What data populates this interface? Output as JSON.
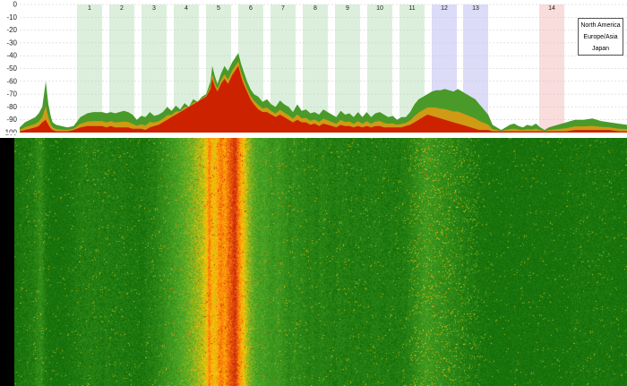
{
  "spectrum": {
    "y_ticks": [
      "0",
      "-10",
      "-20",
      "-30",
      "-40",
      "-50",
      "-60",
      "-70",
      "-80",
      "-90",
      "-100"
    ],
    "channels": [
      {
        "label": "1",
        "region": "north_america"
      },
      {
        "label": "2",
        "region": "north_america"
      },
      {
        "label": "3",
        "region": "north_america"
      },
      {
        "label": "4",
        "region": "north_america"
      },
      {
        "label": "5",
        "region": "north_america"
      },
      {
        "label": "6",
        "region": "north_america"
      },
      {
        "label": "7",
        "region": "north_america"
      },
      {
        "label": "8",
        "region": "north_america"
      },
      {
        "label": "9",
        "region": "north_america"
      },
      {
        "label": "10",
        "region": "north_america"
      },
      {
        "label": "11",
        "region": "north_america"
      },
      {
        "label": "12",
        "region": "europe_asia"
      },
      {
        "label": "13",
        "region": "europe_asia"
      },
      {
        "label": "14",
        "region": "japan"
      }
    ],
    "legend": {
      "north_america": "North America",
      "europe_asia": "Europe/Asia",
      "japan": "Japan"
    },
    "colors": {
      "north_america": "#dcefdc",
      "europe_asia": "#dcdcf8",
      "japan": "#f9dcdc",
      "trace_green": "#4a9a2a",
      "trace_red": "#cc2200",
      "trace_orange": "#e89a10"
    }
  },
  "chart_data": {
    "type": "area",
    "ylim": [
      -100,
      0
    ],
    "x": [
      0,
      6,
      12,
      18,
      22,
      26,
      30,
      33,
      36,
      38,
      42,
      48,
      55,
      62,
      70,
      78,
      85,
      90,
      95,
      100,
      105,
      110,
      115,
      120,
      125,
      130,
      135,
      140,
      145,
      150,
      155,
      160,
      165,
      170,
      175,
      180,
      185,
      190,
      195,
      200,
      205,
      210,
      215,
      220,
      222,
      225,
      228,
      232,
      236,
      240,
      245,
      250,
      252,
      255,
      258,
      262,
      266,
      270,
      275,
      280,
      285,
      290,
      295,
      300,
      305,
      310,
      315,
      320,
      325,
      330,
      335,
      340,
      345,
      350,
      355,
      360,
      365,
      370,
      375,
      380,
      385,
      390,
      395,
      400,
      405,
      410,
      415,
      420,
      425,
      430,
      435,
      440,
      445,
      450,
      455,
      460,
      465,
      470,
      475,
      480,
      485,
      490,
      495,
      500,
      505,
      510,
      515,
      520,
      525,
      530,
      535,
      540,
      545,
      550,
      555,
      560,
      565,
      570,
      575,
      580,
      585,
      590,
      595,
      600,
      605,
      610,
      615,
      620,
      625,
      630,
      640,
      650,
      660,
      670,
      680,
      690,
      700
    ],
    "series": [
      {
        "values": [
          -96,
          -92,
          -90,
          -88,
          -85,
          -80,
          -60,
          -78,
          -88,
          -92,
          -94,
          -95,
          -96,
          -95,
          -88,
          -85,
          -84,
          -84,
          -84,
          -85,
          -84,
          -85,
          -84,
          -83,
          -84,
          -86,
          -90,
          -87,
          -88,
          -84,
          -87,
          -86,
          -84,
          -80,
          -83,
          -79,
          -82,
          -77,
          -80,
          -74,
          -76,
          -72,
          -70,
          -60,
          -48,
          -56,
          -62,
          -54,
          -48,
          -52,
          -45,
          -40,
          -38,
          -46,
          -52,
          -60,
          -66,
          -70,
          -72,
          -76,
          -74,
          -78,
          -80,
          -75,
          -78,
          -80,
          -84,
          -78,
          -83,
          -82,
          -85,
          -84,
          -86,
          -82,
          -84,
          -86,
          -88,
          -83,
          -86,
          -85,
          -88,
          -84,
          -88,
          -84,
          -88,
          -85,
          -84,
          -86,
          -88,
          -87,
          -90,
          -88,
          -88,
          -84,
          -78,
          -74,
          -72,
          -70,
          -68,
          -67,
          -67,
          -66,
          -67,
          -68,
          -66,
          -68,
          -70,
          -72,
          -74,
          -78,
          -82,
          -86,
          -94,
          -96,
          -98,
          -96,
          -94,
          -93,
          -95,
          -96,
          -94,
          -95,
          -93,
          -96,
          -98,
          -96,
          -95,
          -94,
          -93,
          -92,
          -90,
          -90,
          -89,
          -91,
          -92,
          -93,
          -94
        ]
      },
      {
        "values": [
          -99,
          -98,
          -97,
          -96,
          -95,
          -92,
          -90,
          -94,
          -97,
          -98,
          -99,
          -99,
          -99,
          -98,
          -96,
          -95,
          -95,
          -95,
          -95,
          -96,
          -95,
          -96,
          -96,
          -96,
          -96,
          -97,
          -97,
          -97,
          -98,
          -96,
          -95,
          -94,
          -92,
          -90,
          -88,
          -86,
          -84,
          -82,
          -80,
          -78,
          -76,
          -74,
          -72,
          -66,
          -58,
          -64,
          -68,
          -62,
          -58,
          -62,
          -55,
          -50,
          -48,
          -56,
          -62,
          -68,
          -74,
          -78,
          -82,
          -84,
          -84,
          -86,
          -88,
          -86,
          -88,
          -90,
          -92,
          -90,
          -92,
          -92,
          -94,
          -93,
          -95,
          -93,
          -94,
          -95,
          -96,
          -94,
          -95,
          -95,
          -96,
          -95,
          -96,
          -95,
          -96,
          -95,
          -95,
          -96,
          -96,
          -96,
          -96,
          -96,
          -95,
          -94,
          -92,
          -90,
          -88,
          -86,
          -87,
          -88,
          -89,
          -90,
          -91,
          -92,
          -93,
          -94,
          -95,
          -96,
          -97,
          -98,
          -98,
          -98,
          -99,
          -99,
          -99,
          -99,
          -99,
          -99,
          -99,
          -99,
          -99,
          -99,
          -99,
          -99,
          -99,
          -99,
          -99,
          -99,
          -99,
          -99,
          -98,
          -98,
          -98,
          -98,
          -98,
          -99,
          -99
        ]
      }
    ]
  }
}
